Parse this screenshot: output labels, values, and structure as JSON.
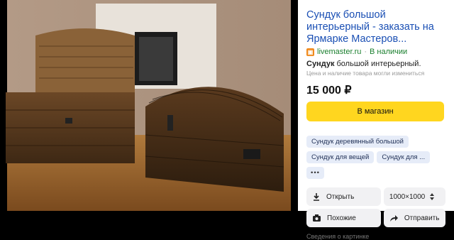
{
  "product": {
    "title": "Сундук большой интерьерный - заказать на Ярмарке Мастеров...",
    "domain": "livemaster.ru",
    "availability": "В наличии",
    "description_bold": "Сундук",
    "description_rest": " большой интерьерный.",
    "price_note": "Цена и наличие товара могли измениться",
    "price": "15 000 ₽",
    "shop_button": "В магазин"
  },
  "tags": [
    "Сундук деревянный большой",
    "Сундук для вещей",
    "Сундук для ..."
  ],
  "tag_more": "•••",
  "actions": {
    "open": "Открыть",
    "size": "1000×1000",
    "similar": "Похожие",
    "share": "Отправить"
  },
  "bottom_text": "Сведения о картинке",
  "icons": {
    "favicon": "livemaster-favicon",
    "open": "download-icon",
    "similar": "camera-icon",
    "share": "share-arrow-icon",
    "size": "stepper-icon"
  },
  "colors": {
    "title": "#1a4fb4",
    "shop_button": "#ffd61f",
    "tag_bg": "#e6ecf8",
    "availability": "#1a7f2e"
  }
}
